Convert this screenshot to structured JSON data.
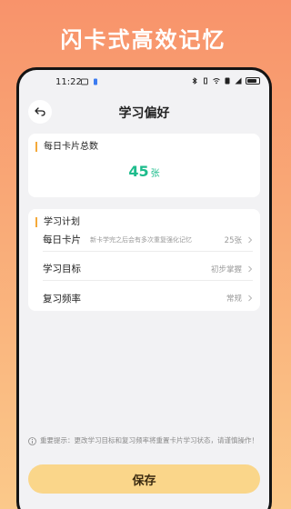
{
  "promo": {
    "title": "闪卡式高效记忆"
  },
  "status_bar": {
    "time": "11:22"
  },
  "header": {
    "title": "学习偏好"
  },
  "daily_card": {
    "title": "每日卡片总数",
    "value": "45",
    "unit": "张"
  },
  "plan": {
    "title": "学习计划",
    "rows": [
      {
        "label": "每日卡片",
        "note": "新卡学完之后会有多次重复强化记忆",
        "value": "25张"
      },
      {
        "label": "学习目标",
        "note": "",
        "value": "初步掌握"
      },
      {
        "label": "复习频率",
        "note": "",
        "value": "常规"
      }
    ]
  },
  "tip": {
    "text": "重要提示：更改学习目标和复习频率将重置卡片学习状态，请谨慎操作！"
  },
  "actions": {
    "save_label": "保存"
  },
  "colors": {
    "accent_green": "#1ebc8c",
    "accent_orange": "#f4a93a",
    "button_yellow": "#fad68a"
  }
}
